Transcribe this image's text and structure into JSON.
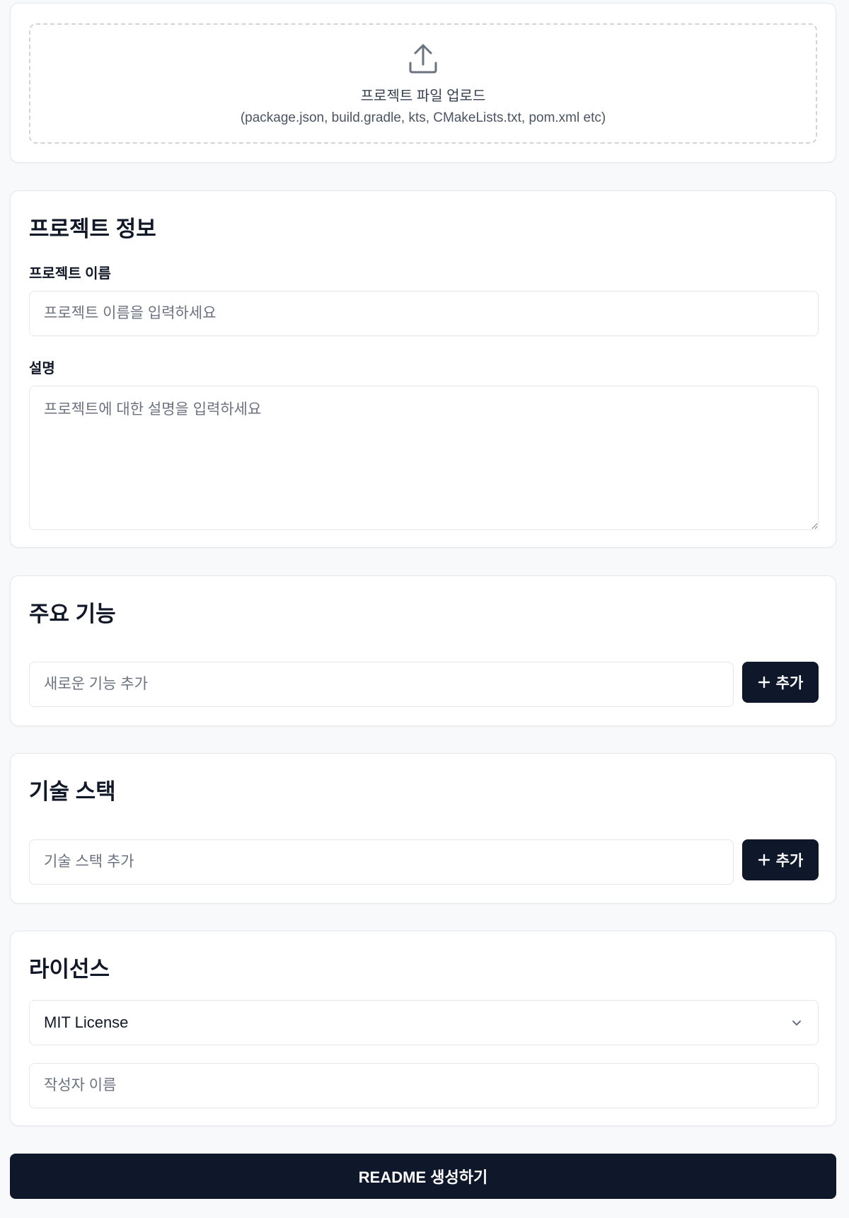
{
  "upload": {
    "title": "프로젝트 파일 업로드",
    "subtitle": "(package.json, build.gradle, kts, CMakeLists.txt, pom.xml etc)",
    "icon": "upload-icon"
  },
  "project_info": {
    "title": "프로젝트 정보",
    "name_label": "프로젝트 이름",
    "name_value": "",
    "name_placeholder": "프로젝트 이름을 입력하세요",
    "description_label": "설명",
    "description_value": "",
    "description_placeholder": "프로젝트에 대한 설명을 입력하세요"
  },
  "features": {
    "title": "주요 기능",
    "input_value": "",
    "input_placeholder": "새로운 기능 추가",
    "add_label": "추가",
    "add_icon": "plus-icon"
  },
  "tech_stack": {
    "title": "기술 스택",
    "input_value": "",
    "input_placeholder": "기술 스택 추가",
    "add_label": "추가",
    "add_icon": "plus-icon"
  },
  "license": {
    "title": "라이선스",
    "selected": "MIT License",
    "select_icon": "chevron-down-icon",
    "author_value": "",
    "author_placeholder": "작성자 이름"
  },
  "generate_button": {
    "label": "README 생성하기"
  },
  "colors": {
    "page_background": "#f8f9fb",
    "card_background": "#ffffff",
    "border": "#e5e7eb",
    "dashed_border": "#d1d5db",
    "primary_button": "#0f172a",
    "placeholder": "#6b7280"
  }
}
